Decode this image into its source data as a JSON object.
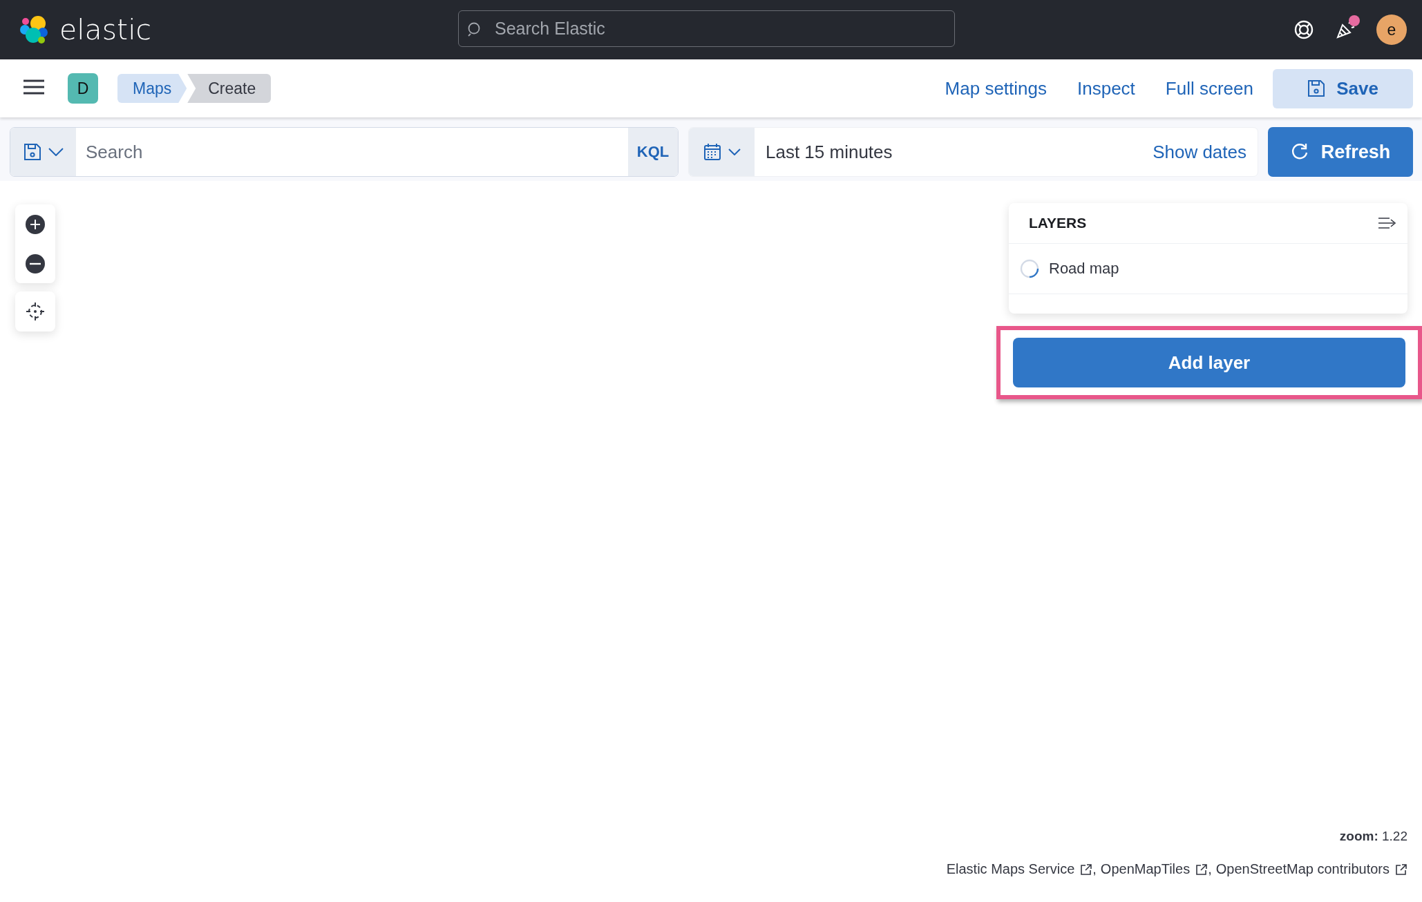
{
  "header": {
    "logo_text": "elastic",
    "search": {
      "placeholder": "Search Elastic"
    },
    "notification_unread": true,
    "avatar_initial": "e"
  },
  "nav": {
    "space_initial": "D",
    "breadcrumbs": [
      {
        "label": "Maps",
        "current": false
      },
      {
        "label": "Create",
        "current": true
      }
    ],
    "links": [
      "Map settings",
      "Inspect",
      "Full screen"
    ],
    "save_button": "Save"
  },
  "query_bar": {
    "search": {
      "placeholder": "Search"
    },
    "language": "KQL",
    "time_range": "Last 15 minutes",
    "show_dates": "Show dates",
    "refresh_button": "Refresh"
  },
  "map": {
    "layers_panel": {
      "title": "LAYERS",
      "layers": [
        {
          "name": "Road map",
          "loading": true
        }
      ],
      "add_layer_button": "Add layer",
      "add_layer_highlighted": true
    },
    "zoom": {
      "label": "zoom:",
      "value": "1.22"
    },
    "attribution_separator": ",",
    "attributions": [
      "Elastic Maps Service",
      "OpenMapTiles",
      "OpenStreetMap contributors"
    ]
  }
}
